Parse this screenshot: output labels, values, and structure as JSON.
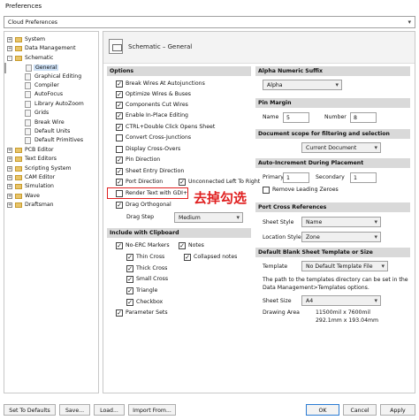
{
  "window": {
    "title": "Preferences"
  },
  "profile_combo": {
    "value": "Cloud Preferences"
  },
  "tree": [
    {
      "label": "System",
      "expander": "+"
    },
    {
      "label": "Data Management",
      "expander": "+"
    },
    {
      "label": "Schematic",
      "expander": "-"
    },
    {
      "label": "General"
    },
    {
      "label": "Graphical Editing"
    },
    {
      "label": "Compiler"
    },
    {
      "label": "AutoFocus"
    },
    {
      "label": "Library AutoZoom"
    },
    {
      "label": "Grids"
    },
    {
      "label": "Break Wire"
    },
    {
      "label": "Default Units"
    },
    {
      "label": "Default Primitives"
    },
    {
      "label": "PCB Editor",
      "expander": "+"
    },
    {
      "label": "Text Editors",
      "expander": "+"
    },
    {
      "label": "Scripting System",
      "expander": "+"
    },
    {
      "label": "CAM Editor",
      "expander": "+"
    },
    {
      "label": "Simulation",
      "expander": "+"
    },
    {
      "label": "Wave",
      "expander": "+"
    },
    {
      "label": "Draftsman",
      "expander": "+"
    }
  ],
  "page_header": {
    "title": "Schematic – General"
  },
  "options": {
    "header": "Options",
    "items": [
      {
        "label": "Break Wires At Autojunctions",
        "checked": true
      },
      {
        "label": "Optimize Wires & Buses",
        "checked": true
      },
      {
        "label": "Components Cut Wires",
        "checked": true
      },
      {
        "label": "Enable In-Place Editing",
        "checked": true
      },
      {
        "label": "CTRL+Double Click Opens Sheet",
        "checked": true
      },
      {
        "label": "Convert Cross-Junctions",
        "checked": false
      },
      {
        "label": "Display Cross-Overs",
        "checked": false
      },
      {
        "label": "Pin Direction",
        "checked": true
      },
      {
        "label": "Sheet Entry Direction",
        "checked": true
      },
      {
        "label": "Port Direction",
        "checked": true
      },
      {
        "label": "Unconnected Left To Right",
        "checked": true
      },
      {
        "label": "Render Text with GDI+",
        "checked": false
      },
      {
        "label": "Drag Orthogonal",
        "checked": true
      }
    ],
    "drag_step_label": "Drag Step",
    "drag_step_value": "Medium"
  },
  "clipboard": {
    "header": "Include with Clipboard",
    "items": [
      {
        "label": "No-ERC Markers",
        "checked": true
      },
      {
        "label": "Notes",
        "checked": true
      },
      {
        "label": "Thin Cross",
        "checked": true
      },
      {
        "label": "Collapsed notes",
        "checked": true
      },
      {
        "label": "Thick Cross",
        "checked": true
      },
      {
        "label": "Small Cross",
        "checked": true
      },
      {
        "label": "Triangle",
        "checked": true
      },
      {
        "label": "Checkbox",
        "checked": true
      },
      {
        "label": "Parameter Sets",
        "checked": true
      }
    ]
  },
  "alpha_suffix": {
    "header": "Alpha Numeric Suffix",
    "value": "Alpha"
  },
  "pin_margin": {
    "header": "Pin Margin",
    "name_label": "Name",
    "name_value": "5",
    "number_label": "Number",
    "number_value": "8"
  },
  "doc_scope": {
    "header": "Document scope for filtering and selection",
    "value": "Current Document"
  },
  "auto_increment": {
    "header": "Auto-Increment During Placement",
    "primary_label": "Primary",
    "primary_value": "1",
    "secondary_label": "Secondary",
    "secondary_value": "1",
    "remove_zeroes_label": "Remove Leading Zeroes",
    "remove_zeroes_checked": false
  },
  "port_cross": {
    "header": "Port Cross References",
    "sheet_style_label": "Sheet Style",
    "sheet_style_value": "Name",
    "location_style_label": "Location Style",
    "location_style_value": "Zone"
  },
  "blank_sheet": {
    "header": "Default Blank Sheet Template or Size",
    "template_label": "Template",
    "template_value": "No Default Template File",
    "description": "The path to the templates directory can be set in the Data Management>Templates options.",
    "sheet_size_label": "Sheet Size",
    "sheet_size_value": "A4",
    "drawing_area_label": "Drawing Area",
    "drawing_area_mil": "11500mil x 7600mil",
    "drawing_area_mm": "292.1mm x 193.04mm"
  },
  "annotation": {
    "text": "去掉勾选",
    "color": "#e02020"
  },
  "buttons": {
    "set_defaults": "Set To Defaults",
    "save": "Save...",
    "load": "Load...",
    "import_from": "Import From...",
    "ok": "OK",
    "cancel": "Cancel",
    "apply": "Apply"
  }
}
